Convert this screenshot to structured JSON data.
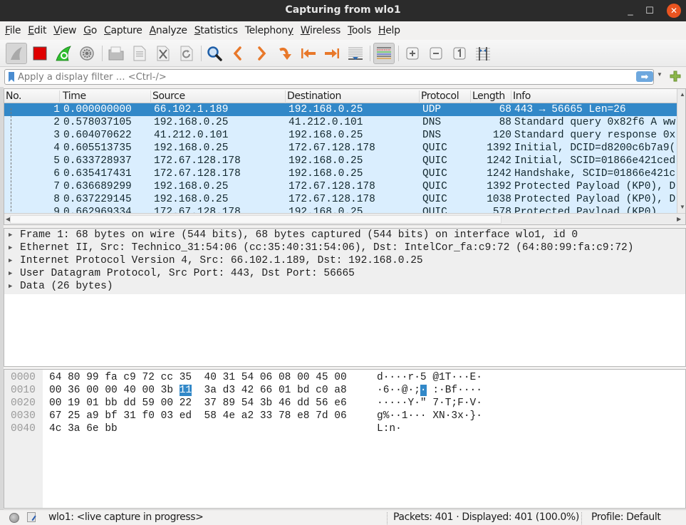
{
  "window": {
    "title": "Capturing from wlo1",
    "minimize": "_",
    "maximize": "☐",
    "close": "✕"
  },
  "menu": [
    {
      "key": "F",
      "rest": "ile"
    },
    {
      "key": "E",
      "rest": "dit"
    },
    {
      "key": "V",
      "rest": "iew"
    },
    {
      "key": "G",
      "rest": "o"
    },
    {
      "key": "C",
      "rest": "apture"
    },
    {
      "key": "A",
      "rest": "nalyze"
    },
    {
      "key": "S",
      "rest": "tatistics"
    },
    {
      "key": "",
      "rest": "Telephon",
      "tail_key": "y"
    },
    {
      "key": "W",
      "rest": "ireless"
    },
    {
      "key": "T",
      "rest": "ools"
    },
    {
      "key": "H",
      "rest": "elp"
    }
  ],
  "toolbar": {
    "icons": [
      "start-capture-icon",
      "stop-capture-icon",
      "restart-capture-icon",
      "capture-options-icon",
      "open-file-icon",
      "save-file-icon",
      "close-file-icon",
      "reload-file-icon",
      "find-packet-icon",
      "go-back-icon",
      "go-forward-icon",
      "go-to-packet-icon",
      "first-packet-icon",
      "last-packet-icon",
      "auto-scroll-icon",
      "colorize-icon",
      "zoom-in-icon",
      "zoom-out-icon",
      "normal-size-icon",
      "resize-columns-icon"
    ]
  },
  "filter": {
    "placeholder": "Apply a display filter … <Ctrl-/>",
    "value": "",
    "apply_glyph": "➡"
  },
  "packet_list": {
    "columns": [
      "No.",
      "Time",
      "Source",
      "Destination",
      "Protocol",
      "Length",
      "Info"
    ],
    "rows": [
      {
        "no": "1",
        "time": "0.000000000",
        "src": "66.102.1.189",
        "dst": "192.168.0.25",
        "proto": "UDP",
        "len": "68",
        "info": "443 → 56665 Len=26",
        "selected": true
      },
      {
        "no": "2",
        "time": "0.578037105",
        "src": "192.168.0.25",
        "dst": "41.212.0.101",
        "proto": "DNS",
        "len": "88",
        "info": "Standard query 0x82f6 A ww"
      },
      {
        "no": "3",
        "time": "0.604070622",
        "src": "41.212.0.101",
        "dst": "192.168.0.25",
        "proto": "DNS",
        "len": "120",
        "info": "Standard query response 0x"
      },
      {
        "no": "4",
        "time": "0.605513735",
        "src": "192.168.0.25",
        "dst": "172.67.128.178",
        "proto": "QUIC",
        "len": "1392",
        "info": "Initial, DCID=d8200c6b7a9("
      },
      {
        "no": "5",
        "time": "0.633728937",
        "src": "172.67.128.178",
        "dst": "192.168.0.25",
        "proto": "QUIC",
        "len": "1242",
        "info": "Initial, SCID=01866e421ced"
      },
      {
        "no": "6",
        "time": "0.635417431",
        "src": "172.67.128.178",
        "dst": "192.168.0.25",
        "proto": "QUIC",
        "len": "1242",
        "info": "Handshake, SCID=01866e421c"
      },
      {
        "no": "7",
        "time": "0.636689299",
        "src": "192.168.0.25",
        "dst": "172.67.128.178",
        "proto": "QUIC",
        "len": "1392",
        "info": "Protected Payload (KP0), D"
      },
      {
        "no": "8",
        "time": "0.637229145",
        "src": "192.168.0.25",
        "dst": "172.67.128.178",
        "proto": "QUIC",
        "len": "1038",
        "info": "Protected Payload (KP0), D"
      },
      {
        "no": "9",
        "time": "0.662969334",
        "src": "172.67.128.178",
        "dst": "192.168.0.25",
        "proto": "QUIC",
        "len": "578",
        "info": "Protected Payload (KP0)"
      }
    ]
  },
  "details": [
    "Frame 1: 68 bytes on wire (544 bits), 68 bytes captured (544 bits) on interface wlo1, id 0",
    "Ethernet II, Src: Technico_31:54:06 (cc:35:40:31:54:06), Dst: IntelCor_fa:c9:72 (64:80:99:fa:c9:72)",
    "Internet Protocol Version 4, Src: 66.102.1.189, Dst: 192.168.0.25",
    "User Datagram Protocol, Src Port: 443, Dst Port: 56665",
    "Data (26 bytes)"
  ],
  "bytes": [
    {
      "offset": "0000",
      "hex_a": "64 80 99 fa c9 72 cc 35",
      "hex_b": "40 31 54 06 08 00 45 00",
      "ascii_a": "d····r·5",
      "ascii_b": "@1T···E·"
    },
    {
      "offset": "0010",
      "hex_a_pre": "00 36 00 00 40 00 3b ",
      "hex_a_hl": "11",
      "hex_b": "3a d3 42 66 01 bd c0 a8",
      "ascii_a_pre": "·6··@·;",
      "ascii_a_hl": "·",
      "ascii_b": ":·Bf····"
    },
    {
      "offset": "0020",
      "hex_a": "00 19 01 bb dd 59 00 22",
      "hex_b": "37 89 54 3b 46 dd 56 e6",
      "ascii_a": "·····Y·\"",
      "ascii_b": "7·T;F·V·"
    },
    {
      "offset": "0030",
      "hex_a": "67 25 a9 bf 31 f0 03 ed",
      "hex_b": "58 4e a2 33 78 e8 7d 06",
      "ascii_a": "g%··1···",
      "ascii_b": "XN·3x·}·"
    },
    {
      "offset": "0040",
      "hex_a": "4c 3a 6e bb",
      "hex_b": "",
      "ascii_a": "L:n·",
      "ascii_b": ""
    }
  ],
  "status": {
    "capture_text": "wlo1: <live capture in progress>",
    "packets_text": "Packets: 401 · Displayed: 401 (100.0%)",
    "profile_text": "Profile: Default"
  },
  "colors": {
    "selected_row": "#3288c8",
    "row_bg": "#daeefe",
    "close_button": "#e95420"
  }
}
